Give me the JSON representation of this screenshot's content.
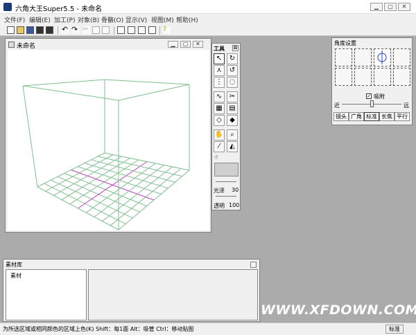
{
  "app": {
    "title": "六角大王Super5.5 - 未命名"
  },
  "menubar": {
    "items": [
      "文件(F)",
      "编辑(E)",
      "加工(P)",
      "对象(B)",
      "骨骼(O)",
      "显示(V)",
      "视图(M)",
      "帮助(H)"
    ]
  },
  "document": {
    "title": "未命名"
  },
  "tools": {
    "title": "工具",
    "close": "⊠",
    "gloss_label": "光泽",
    "gloss_value": "30",
    "transparency_label": "透明",
    "transparency_value": "100"
  },
  "angle_panel": {
    "title": "角度设置",
    "snap_label": "吸附",
    "snap_checked": true,
    "near_label": "近",
    "far_label": "远",
    "tabs": [
      "镜头",
      "广角",
      "标准",
      "长焦",
      "平行"
    ],
    "active_tab": "标准"
  },
  "library": {
    "title": "素材库",
    "tree_item": "素材"
  },
  "status": {
    "text": "为所选区域或相同颜色的区域上色(K)   Shift：每1面   Alt：吸管   Ctrl：移动贴图",
    "mode": "标准"
  },
  "watermark": "WWW.XFDOWN.COM",
  "colors": {
    "workspace": "#ababab",
    "grid_green": "#7fbf8f",
    "grid_magenta": "#c43fbf"
  }
}
